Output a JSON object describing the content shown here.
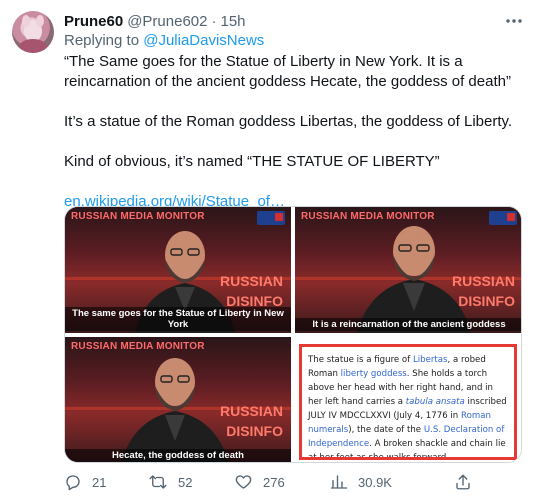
{
  "author": {
    "display_name": "Prune60",
    "handle": "@Prune602",
    "separator": "·",
    "time": "15h"
  },
  "reply": {
    "prefix": "Replying to",
    "mention": "@JuliaDavisNews"
  },
  "body": {
    "p1": "“The Same goes for the Statue of Liberty in New York.  It is a reincarnation of the ancient goddess Hecate, the goddess of death”",
    "p2": "It’s a statue of the Roman goddess Libertas, the goddess of Liberty.",
    "p3": "Kind of obvious, it’s named “THE STATUE OF LIBERTY”",
    "link": "en.wikipedia.org/wiki/Statue_of…"
  },
  "media": {
    "tiles": [
      {
        "monitor": "RUSSIAN MEDIA MONITOR",
        "disinfo_1": "RUSSIAN",
        "disinfo_2": "DISINFO",
        "caption": "The same goes for the Statue of Liberty in New York"
      },
      {
        "monitor": "RUSSIAN MEDIA MONITOR",
        "disinfo_1": "RUSSIAN",
        "disinfo_2": "DISINFO",
        "caption": "It is a reincarnation of the ancient goddess"
      },
      {
        "monitor": "RUSSIAN MEDIA MONITOR",
        "disinfo_1": "RUSSIAN",
        "disinfo_2": "DISINFO",
        "caption": "Hecate, the goddess of death"
      }
    ],
    "wiki": {
      "s1": "The statue is a figure of ",
      "l1": "Libertas",
      "s2": ", a robed Roman ",
      "l2": "liberty goddess",
      "s3": ". She holds a torch above her head with her right hand, and in her left hand carries a ",
      "l3": "tabula ansata",
      "s4": " inscribed JULY IV MDCCLXXVI (July 4, 1776 in ",
      "l4": "Roman numerals",
      "s5": "), the date of the ",
      "l5": "U.S. Declaration of Independence",
      "s6": ". A broken shackle and chain lie at her feet as she walks forward, commemorating the recent national abolition of"
    }
  },
  "actions": {
    "replies": "21",
    "retweets": "52",
    "likes": "276",
    "views": "30.9K"
  },
  "colors": {
    "accent": "#1d9bf0",
    "secondary_text": "#536471",
    "highlight_border": "#e53935"
  }
}
